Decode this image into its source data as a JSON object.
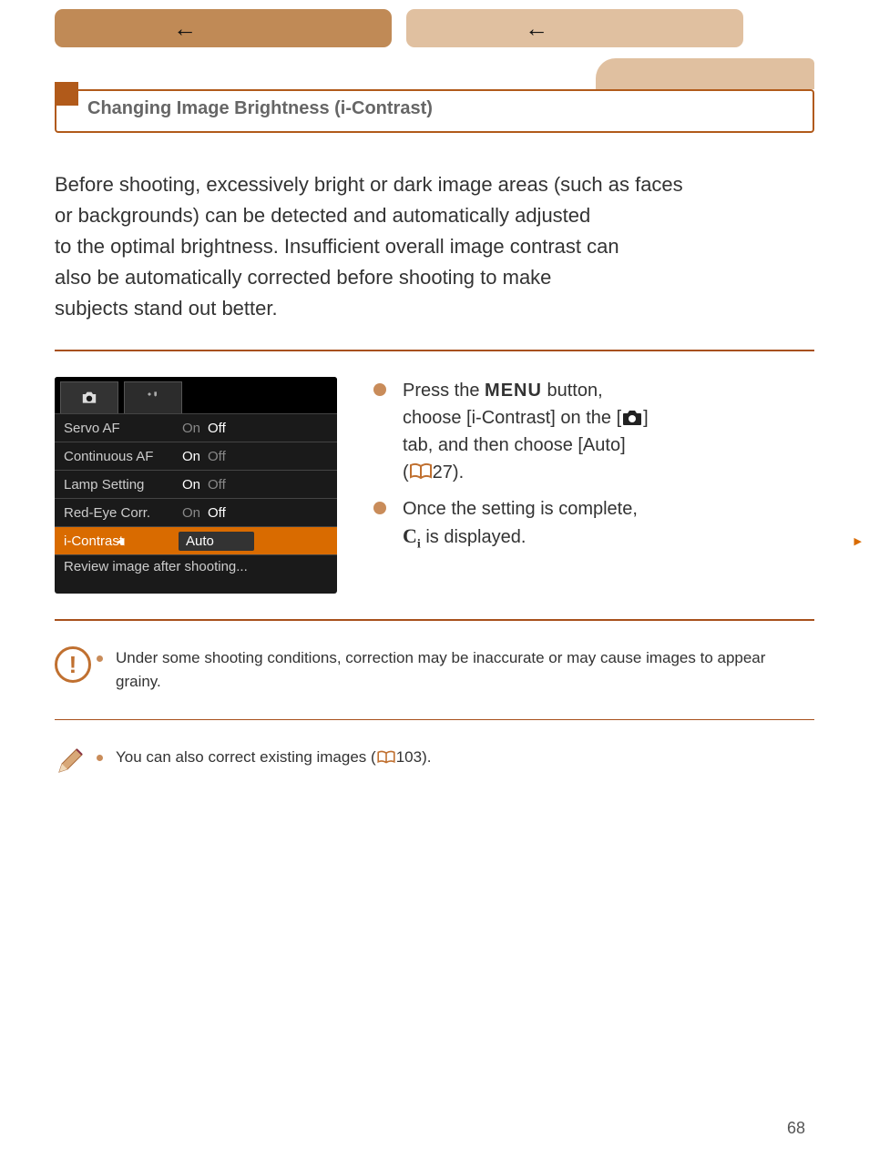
{
  "title": "Changing Image Brightness (i-Contrast)",
  "intro_lines": [
    "Before shooting, excessively bright or dark image areas (such as faces",
    "or backgrounds) can be detected and automatically adjusted",
    "to the optimal brightness. Insufficient overall image contrast can",
    "also be automatically corrected before shooting to make",
    "subjects stand out better."
  ],
  "menu_screenshot": {
    "rows": [
      {
        "label": "Servo AF",
        "on": "On",
        "off": "Off",
        "on_active": false
      },
      {
        "label": "Continuous AF",
        "on": "On",
        "off": "Off",
        "on_active": true
      },
      {
        "label": "Lamp Setting",
        "on": "On",
        "off": "Off",
        "on_active": true
      },
      {
        "label": "Red-Eye Corr.",
        "on": "On",
        "off": "Off",
        "on_active": false
      }
    ],
    "selected": {
      "label": "i-Contrast",
      "value": "Auto"
    },
    "last": "Review image after shooting..."
  },
  "instructions": {
    "item1_a": "Press the ",
    "item1_menu": "MENU",
    "item1_b": " button,",
    "item1_c": "choose [i-Contrast] on the [",
    "item1_d": "]",
    "item1_e": "tab, and then choose [Auto]",
    "item1_f": "(",
    "item1_ref": "27",
    "item1_g": ").",
    "item2_a": "Once the setting is complete,",
    "item2_b": " is displayed."
  },
  "caution": "Under some shooting conditions, correction may be inaccurate or may cause images to appear grainy.",
  "note_a": "You can also correct existing images (",
  "note_ref": "103",
  "note_b": ").",
  "page_number": "68"
}
